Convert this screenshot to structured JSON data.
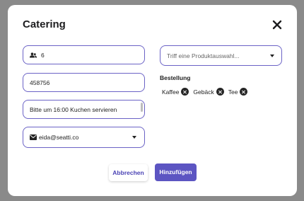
{
  "dialog": {
    "title": "Catering"
  },
  "form": {
    "guests_value": "6",
    "cost_center_value": "458756",
    "note_value": "Bitte um 16:00 Kuchen servieren",
    "email_value": "eida@seatti.co",
    "product_placeholder": "Triff eine Produktauswahl..."
  },
  "order": {
    "heading": "Bestellung",
    "items": [
      "Kaffee",
      "Gebäck",
      "Tee"
    ]
  },
  "actions": {
    "cancel_label": "Abbrechen",
    "add_label": "Hinzufügen"
  },
  "colors": {
    "accent": "#5c55c2",
    "field_border": "#6b63c6",
    "overlay": "#8a8a8a"
  },
  "icons": {
    "close": "close-icon",
    "guests": "people-icon",
    "email": "mail-icon",
    "dropdown": "chevron-down-icon",
    "remove_item": "remove-circle-icon"
  }
}
